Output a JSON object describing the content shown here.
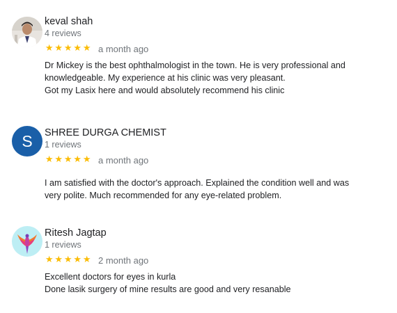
{
  "reviews": [
    {
      "reviewer": "keval shah",
      "review_count": "4 reviews",
      "rating": 5,
      "time_ago": "a month ago",
      "lines": [
        "Dr Mickey is the best ophthalmologist in the town. He is very professional and",
        "knowledgeable. My experience at his clinic was very pleasant.",
        "Got my Lasix here and would absolutely recommend his clinic"
      ],
      "avatar_icon": "person-photo-icon"
    },
    {
      "reviewer": "SHREE DURGA CHEMIST",
      "review_count": "1 reviews",
      "rating": 5,
      "time_ago": "a month ago",
      "lines": [
        "I am satisfied with the doctor's approach. Explained the condition well and was",
        "very polite. Much recommended for any eye-related problem."
      ],
      "avatar_initial": "S",
      "avatar_color": "#1a5fa8"
    },
    {
      "reviewer": "Ritesh Jagtap",
      "review_count": "1 reviews",
      "rating": 5,
      "time_ago": "2 month ago",
      "lines": [
        "Excellent doctors for eyes in kurla",
        "Done lasik surgery of mine results are good and very resanable"
      ],
      "avatar_icon": "phoenix-logo-icon"
    }
  ],
  "star_glyph": "★",
  "star_color": "#fbbc04"
}
